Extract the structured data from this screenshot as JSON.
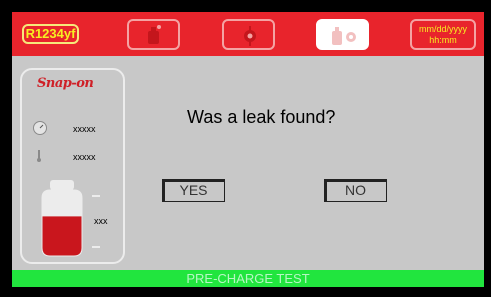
{
  "header": {
    "refrigerant": "R1234yf",
    "tabs": [
      {
        "icon": "oil-bottle-icon",
        "active": false
      },
      {
        "icon": "dye-injection-icon",
        "active": false
      },
      {
        "icon": "leak-test-icon",
        "active": true
      }
    ],
    "date_line": "mm/dd/yyyy",
    "time_line": "hh:mm"
  },
  "side": {
    "brand": "Snap-on",
    "pressure_value": "xxxxx",
    "temperature_value": "xxxxx",
    "tank_value": "xxx",
    "tank_fill_percent": 60
  },
  "dialog": {
    "question": "Was a leak found?",
    "yes_label": "YES",
    "no_label": "NO"
  },
  "footer": {
    "status": "PRE-CHARGE TEST"
  },
  "colors": {
    "header_red": "#e8242c",
    "text_yellow": "#f6ef22",
    "status_green": "#21e53e",
    "panel_gray": "#c8c8c8"
  }
}
